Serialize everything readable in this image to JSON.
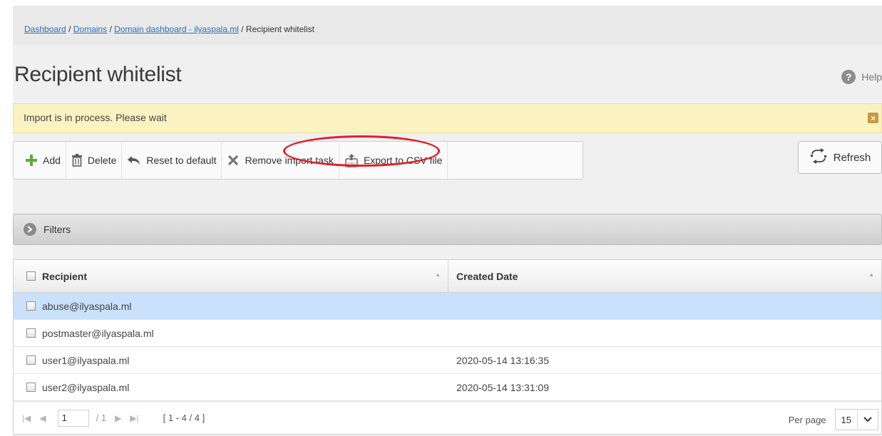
{
  "breadcrumb": {
    "items": [
      "Dashboard",
      "Domains",
      "Domain dashboard - ilyaspala.ml"
    ],
    "current": "Recipient whitelist",
    "separator": "/"
  },
  "page": {
    "title": "Recipient whitelist",
    "help_label": "Help",
    "help_icon": "question-circle-icon"
  },
  "notice": {
    "text": "Import is in process. Please wait",
    "close_icon": "close-icon"
  },
  "toolbar": {
    "add_label": "Add",
    "delete_label": "Delete",
    "reset_label": "Reset to default",
    "remove_import_label": "Remove import task",
    "export_label": "Export to CSV file",
    "refresh_label": "Refresh"
  },
  "filters": {
    "label": "Filters"
  },
  "grid": {
    "columns": [
      "Recipient",
      "Created Date"
    ],
    "rows": [
      {
        "recipient": "abuse@ilyaspala.ml",
        "created": ""
      },
      {
        "recipient": "postmaster@ilyaspala.ml",
        "created": ""
      },
      {
        "recipient": "user1@ilyaspala.ml",
        "created": "2020-05-14 13:16:35"
      },
      {
        "recipient": "user2@ilyaspala.ml",
        "created": "2020-05-14 13:31:09"
      }
    ]
  },
  "pager": {
    "page_value": "1",
    "total_pages": "/ 1",
    "range": "[ 1 - 4 / 4 ]",
    "per_page_label": "Per page",
    "per_page_value": "15"
  },
  "colors": {
    "link": "#2a6ebb",
    "notice_bg": "#fbf2c1",
    "selected_row": "#c9e1fa",
    "highlight": "#e0202a",
    "add_icon": "#5fa93d"
  }
}
